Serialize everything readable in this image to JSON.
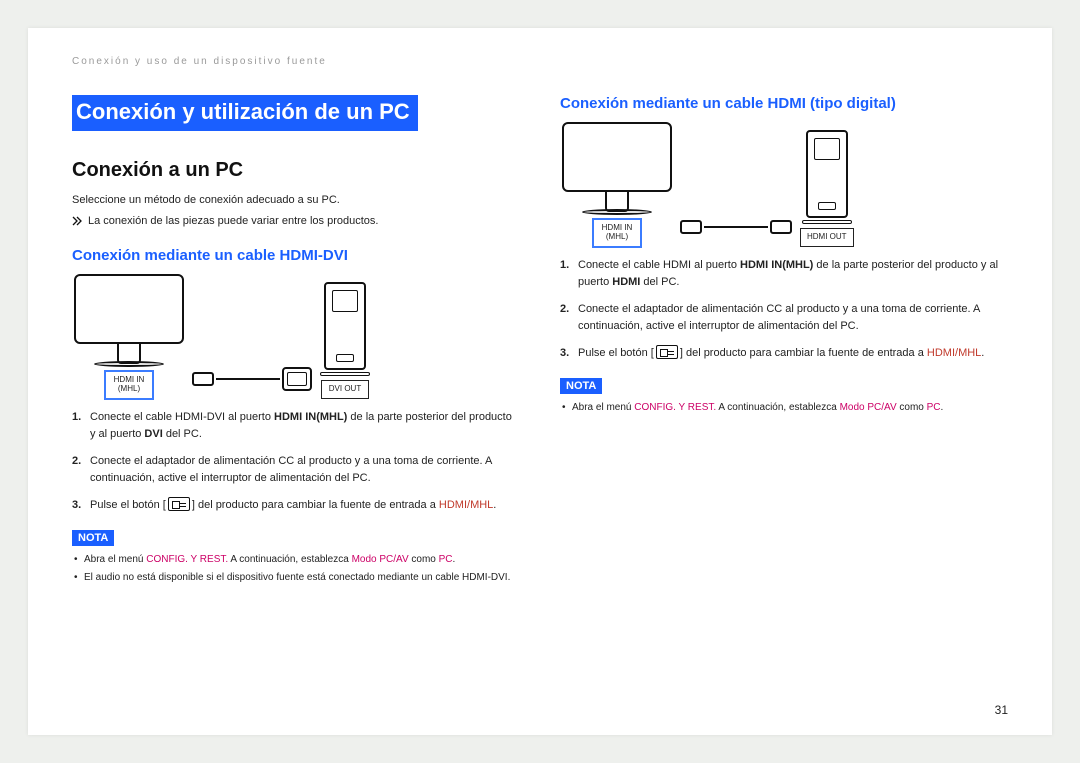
{
  "chapter_header": "Conexión y uso de un dispositivo fuente",
  "page_number": "31",
  "main_title": "Conexión y utilización de un PC",
  "nota_label": "NOTA",
  "left": {
    "h2": "Conexión a un PC",
    "intro": "Seleccione un método de conexión adecuado a su PC.",
    "chev_note": "La conexión de las piezas puede variar entre los productos.",
    "h3": "Conexión mediante un cable HDMI-DVI",
    "diagram": {
      "port_in_line1": "HDMI IN",
      "port_in_line2": "(MHL)",
      "port_out": "DVI OUT"
    },
    "steps": {
      "s1_a": "Conecte el cable HDMI-DVI al puerto ",
      "s1_b": "HDMI IN(MHL)",
      "s1_c": " de la parte posterior del producto y al puerto ",
      "s1_d": "DVI",
      "s1_e": " del PC.",
      "s2": "Conecte el adaptador de alimentación CC al producto y a una toma de corriente. A continuación, active el interruptor de alimentación del PC.",
      "s3_a": "Pulse el botón [",
      "s3_b": "] del producto para cambiar la fuente de entrada a ",
      "s3_c": "HDMI/MHL",
      "s3_d": "."
    },
    "nota": {
      "n1_a": "Abra el menú ",
      "n1_b": "CONFIG. Y REST.",
      "n1_c": " A continuación, establezca ",
      "n1_d": "Modo PC/AV",
      "n1_e": " como ",
      "n1_f": "PC",
      "n1_g": ".",
      "n2": "El audio no está disponible si el dispositivo fuente está conectado mediante un cable HDMI-DVI."
    }
  },
  "right": {
    "h3": "Conexión mediante un cable HDMI (tipo digital)",
    "diagram": {
      "port_in_line1": "HDMI IN",
      "port_in_line2": "(MHL)",
      "port_out": "HDMI OUT"
    },
    "steps": {
      "s1_a": "Conecte el cable HDMI al puerto ",
      "s1_b": "HDMI IN(MHL)",
      "s1_c": " de la parte posterior del producto y al puerto ",
      "s1_d": "HDMI",
      "s1_e": " del PC.",
      "s2": "Conecte el adaptador de alimentación CC al producto y a una toma de corriente. A continuación, active el interruptor de alimentación del PC.",
      "s3_a": "Pulse el botón [",
      "s3_b": "] del producto para cambiar la fuente de entrada a ",
      "s3_c": "HDMI/MHL",
      "s3_d": "."
    },
    "nota": {
      "n1_a": "Abra el menú ",
      "n1_b": "CONFIG. Y REST.",
      "n1_c": " A continuación, establezca ",
      "n1_d": "Modo PC/AV",
      "n1_e": " como ",
      "n1_f": "PC",
      "n1_g": "."
    }
  }
}
